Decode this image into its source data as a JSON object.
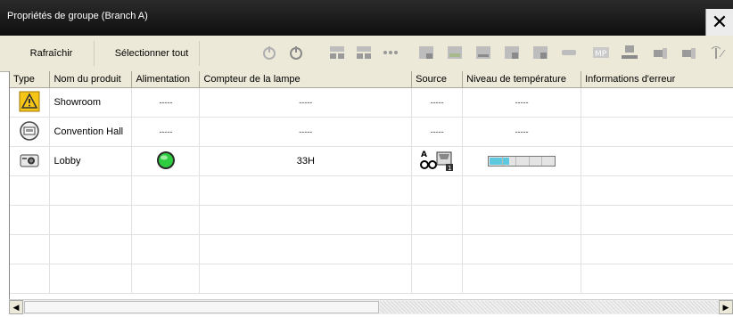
{
  "window": {
    "title": "Propriétés de groupe (Branch A)",
    "close_glyph": "✕"
  },
  "toolbar": {
    "refresh_label": "Rafraîchir",
    "select_all_label": "Sélectionner tout",
    "icons": [
      "power-on-icon",
      "power-off-icon",
      "input-1-icon",
      "input-2-icon",
      "input-dots-icon",
      "input-s-icon",
      "input-video-icon",
      "input-hdmi-icon",
      "input-1b-icon",
      "input-2b-icon",
      "input-bar-icon",
      "input-mp-icon",
      "network-icon",
      "input-c1-icon",
      "input-c2-icon",
      "wireless-icon"
    ]
  },
  "table": {
    "columns": [
      "Type",
      "Nom du produit",
      "Alimentation",
      "Compteur de la lampe",
      "Source",
      "Niveau de température",
      "Informations d'erreur"
    ],
    "rows": [
      {
        "type_icon": "warning-projector-icon",
        "name": "Showroom",
        "power": "-----",
        "lamp": "-----",
        "source": "-----",
        "temperature": "-----",
        "error": ""
      },
      {
        "type_icon": "projector-standby-icon",
        "name": "Convention Hall",
        "power": "-----",
        "lamp": "-----",
        "source": "-----",
        "temperature": "-----",
        "error": ""
      },
      {
        "type_icon": "projector-active-icon",
        "name": "Lobby",
        "power_icon": "power-green-icon",
        "lamp": "33H",
        "source_icon": "computer-input-1-icon",
        "temperature_level": 0.3,
        "error": ""
      }
    ],
    "empty_rows": 4
  },
  "colors": {
    "titlebar": "#1a1a1a",
    "toolbar": "#ece9d8",
    "power_on": "#2ecc40",
    "temperature_fill": "#5ec8de",
    "warning": "#f5c518"
  }
}
